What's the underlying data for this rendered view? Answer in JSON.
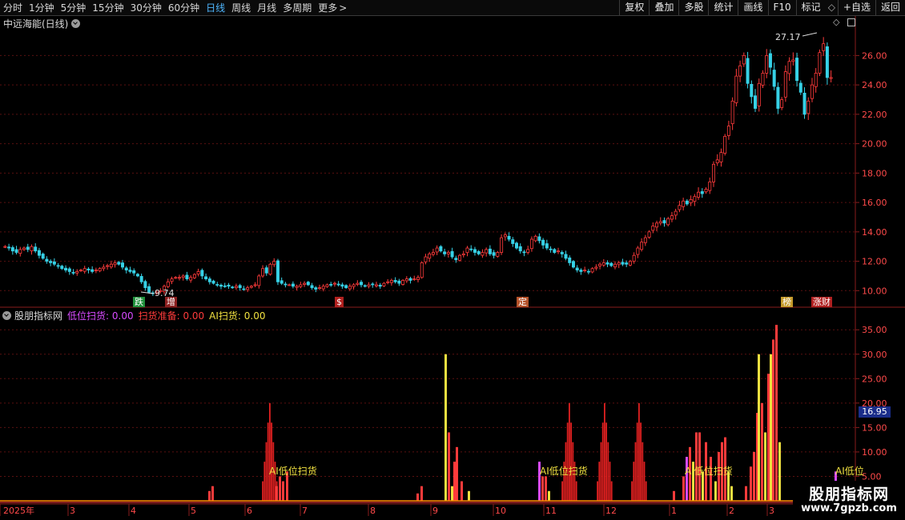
{
  "toolbar": {
    "periods": [
      "分时",
      "1分钟",
      "5分钟",
      "15分钟",
      "30分钟",
      "60分钟",
      "日线",
      "周线",
      "月线",
      "多周期",
      "更多"
    ],
    "active_period": "日线",
    "more_arrow": ">",
    "right_buttons": [
      "复权",
      "叠加",
      "多股",
      "统计",
      "画线",
      "F10",
      "标记",
      "+自选",
      "返回"
    ],
    "right_sep": "◇"
  },
  "stock": {
    "title": "中远海能(日线)"
  },
  "price_panel": {
    "y_labels": [
      "26.00",
      "24.00",
      "22.00",
      "20.00",
      "18.00",
      "16.00",
      "14.00",
      "12.00",
      "10.00"
    ],
    "high_label": "27.17",
    "low_label": "9.74",
    "markers": [
      {
        "text": "跌",
        "color": "#1f8f3a"
      },
      {
        "text": "增",
        "color": "#8a1f1f"
      },
      {
        "text": "$",
        "color": "#b0201e"
      },
      {
        "text": "定",
        "color": "#b5522a"
      },
      {
        "text": "榜",
        "color": "#c59a2a"
      },
      {
        "text": "涨财",
        "color": "#b02020"
      }
    ]
  },
  "indicator": {
    "name": "股朋指标网",
    "items": [
      {
        "label": "低位扫货: 0.00",
        "color": "#d84bff"
      },
      {
        "label": "扫货准备: 0.00",
        "color": "#ff3b3b"
      },
      {
        "label": "AI扫货: 0.00",
        "color": "#f0e040"
      }
    ],
    "y_labels": [
      "35.00",
      "30.00",
      "25.00",
      "20.00",
      "15.00",
      "10.00",
      "5.00"
    ],
    "current_value": "16.95",
    "signal_text": "AI低位扫货",
    "signal_short": "AI低位"
  },
  "timeline": {
    "labels": [
      "2025年",
      "3",
      "4",
      "5",
      "6",
      "7",
      "8",
      "9",
      "10",
      "11",
      "12",
      "1",
      "2",
      "3"
    ]
  },
  "watermark": {
    "title": "股朋指标网",
    "url": "www.7gpzb.com"
  },
  "chart_data": {
    "type": "candlestick+bar",
    "price_ylim": [
      9.2,
      27.6
    ],
    "indicator_ylim": [
      0,
      37
    ],
    "close_series": [
      13.0,
      12.9,
      12.7,
      12.6,
      12.8,
      12.9,
      12.8,
      13.0,
      12.7,
      12.4,
      12.2,
      12.0,
      11.9,
      11.8,
      11.7,
      11.5,
      11.4,
      11.3,
      11.2,
      11.3,
      11.4,
      11.5,
      11.4,
      11.3,
      11.4,
      11.5,
      11.6,
      11.7,
      11.8,
      11.9,
      11.8,
      11.6,
      11.4,
      11.3,
      11.2,
      11.0,
      10.6,
      10.2,
      9.9,
      9.8,
      9.9,
      10.0,
      10.3,
      10.6,
      10.8,
      10.9,
      10.9,
      11.0,
      10.8,
      10.9,
      11.1,
      11.3,
      11.0,
      10.8,
      10.6,
      10.5,
      10.4,
      10.3,
      10.3,
      10.3,
      10.2,
      10.3,
      10.2,
      10.1,
      10.2,
      10.3,
      10.4,
      11.0,
      11.5,
      11.2,
      11.8,
      12.0,
      10.6,
      10.5,
      10.4,
      10.4,
      10.3,
      10.3,
      10.4,
      10.5,
      10.4,
      10.2,
      10.1,
      10.2,
      10.3,
      10.4,
      10.4,
      10.5,
      10.4,
      10.3,
      10.2,
      10.3,
      10.4,
      10.5,
      10.4,
      10.3,
      10.4,
      10.4,
      10.4,
      10.3,
      10.5,
      10.6,
      10.7,
      10.6,
      10.5,
      10.7,
      10.8,
      10.7,
      10.8,
      10.9,
      11.9,
      12.3,
      12.5,
      12.6,
      12.9,
      12.7,
      12.5,
      12.6,
      12.3,
      12.1,
      12.4,
      12.5,
      12.9,
      12.8,
      12.6,
      12.5,
      12.6,
      12.8,
      12.5,
      12.4,
      12.6,
      13.6,
      13.8,
      13.5,
      13.2,
      12.9,
      12.7,
      12.6,
      12.8,
      13.5,
      13.7,
      13.4,
      13.1,
      12.9,
      12.8,
      12.6,
      12.7,
      12.5,
      12.2,
      11.9,
      11.6,
      11.4,
      11.3,
      11.4,
      11.3,
      11.5,
      11.6,
      11.8,
      11.9,
      11.8,
      11.7,
      11.8,
      11.9,
      11.8,
      11.8,
      12.0,
      12.4,
      12.9,
      13.3,
      13.6,
      14.0,
      14.4,
      14.6,
      14.7,
      14.6,
      14.9,
      15.1,
      15.4,
      15.8,
      16.1,
      15.9,
      16.2,
      16.4,
      16.7,
      16.6,
      16.9,
      17.4,
      18.6,
      18.9,
      19.4,
      20.5,
      21.2,
      22.9,
      24.6,
      25.3,
      26.0,
      24.1,
      23.2,
      22.4,
      24.1,
      24.8,
      26.0,
      25.2,
      23.9,
      22.4,
      23.0,
      24.9,
      25.6,
      25.7,
      24.3,
      23.5,
      22.0,
      22.9,
      24.0,
      24.8,
      26.2,
      26.8,
      24.5,
      24.5
    ]
  }
}
